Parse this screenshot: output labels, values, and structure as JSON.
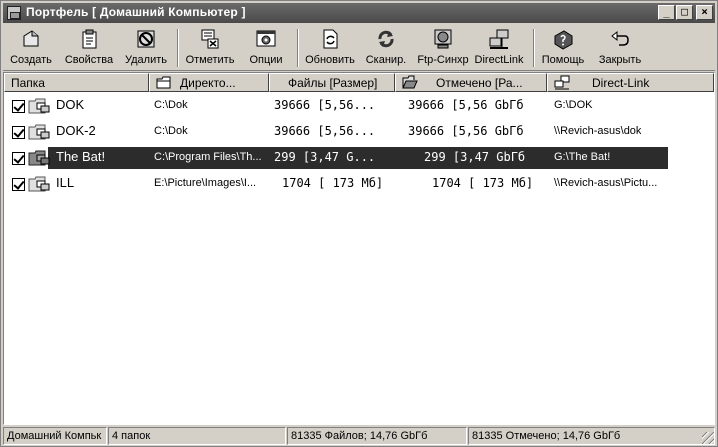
{
  "window": {
    "title": "Портфель [ Домашний Компьютер ]",
    "minimize": "_",
    "maximize": "□",
    "close": "×"
  },
  "toolbar": {
    "create": "Создать",
    "properties": "Свойства",
    "delete": "Удалить",
    "mark": "Отметить",
    "options": "Опции",
    "refresh": "Обновить",
    "scan": "Сканир.",
    "ftp_sync": "Ftp-Синхр",
    "directlink": "DirectLink",
    "help": "Помощь",
    "close": "Закрыть"
  },
  "columns": {
    "folder": "Папка",
    "directory": "Директо...",
    "files": "Файлы [Размер]",
    "marked": "Отмечено [Ра...",
    "direct_link": "Direct-Link"
  },
  "rows": [
    {
      "name": "DOK",
      "directory": "C:\\Dok",
      "files": "39666 [5,56...",
      "marked": "39666 [5,56 GbГб",
      "direct_link": "G:\\DOK",
      "checked": true,
      "selected": false
    },
    {
      "name": "DOK-2",
      "directory": "C:\\Dok",
      "files": "39666 [5,56...",
      "marked": "39666 [5,56 GbГб",
      "direct_link": "\\\\Revich-asus\\dok",
      "checked": true,
      "selected": false
    },
    {
      "name": "The Bat!",
      "directory": "C:\\Program Files\\Th...",
      "files": "299 [3,47 G...",
      "marked": "299 [3,47 GbГб",
      "direct_link": "G:\\The Bat!",
      "checked": true,
      "selected": true
    },
    {
      "name": "ILL",
      "directory": "E:\\Picture\\Images\\I...",
      "files": "1704 [ 173 Мб]",
      "marked": "1704 [ 173 Мб]",
      "direct_link": "\\\\Revich-asus\\Pictu...",
      "checked": true,
      "selected": false
    }
  ],
  "status": {
    "computer": "Домашний Компьк",
    "folders": "4 папок",
    "files": "81335 Файлов; 14,76 GbГб",
    "marked": "81335 Отмечено; 14,76 GbГб"
  }
}
